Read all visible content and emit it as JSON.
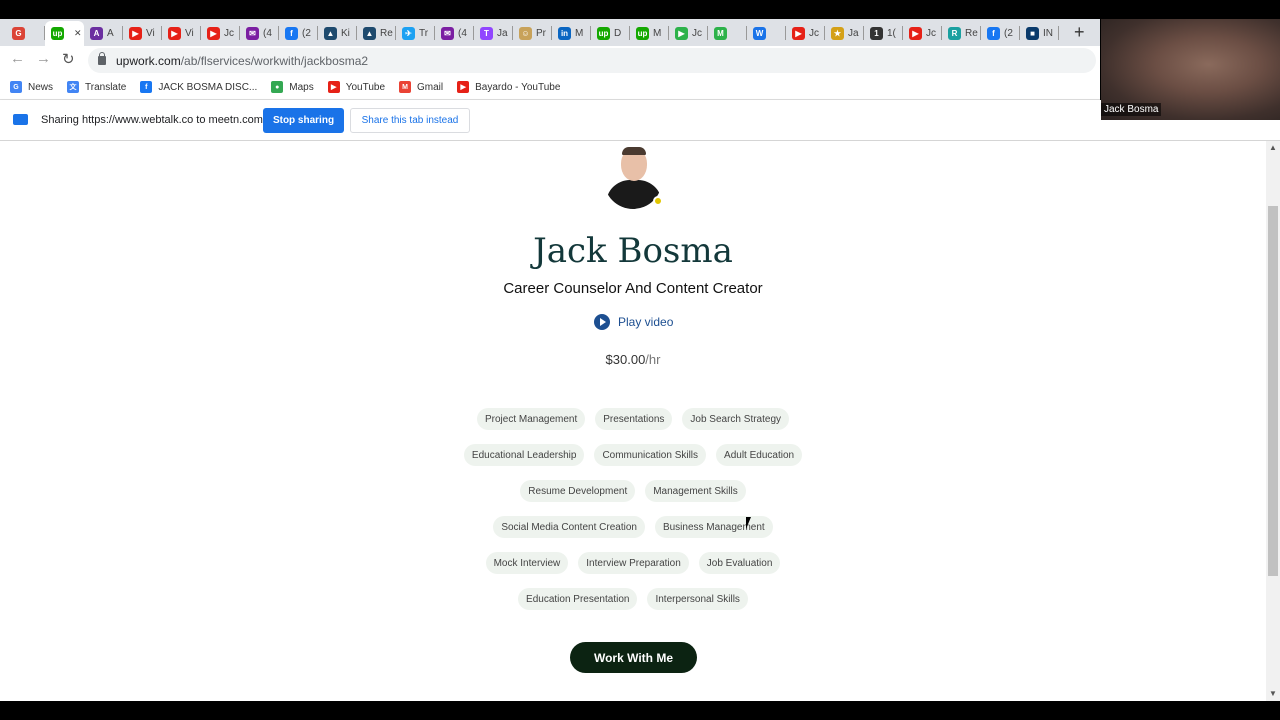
{
  "tabs": [
    {
      "label": "",
      "color": "#db4437",
      "glyph": "G"
    },
    {
      "label": "",
      "color": "#14a800",
      "glyph": "up",
      "active": true
    },
    {
      "label": "A",
      "color": "#6b2fa0",
      "glyph": "A"
    },
    {
      "label": "Vi",
      "color": "#e62117",
      "glyph": "▶"
    },
    {
      "label": "Vi",
      "color": "#e62117",
      "glyph": "▶"
    },
    {
      "label": "Jc",
      "color": "#e62117",
      "glyph": "▶"
    },
    {
      "label": "(4",
      "color": "#7b1fa2",
      "glyph": "✉"
    },
    {
      "label": "(2",
      "color": "#1877f2",
      "glyph": "f"
    },
    {
      "label": "Ki",
      "color": "#1e4a6e",
      "glyph": "▲"
    },
    {
      "label": "Re",
      "color": "#1e4a6e",
      "glyph": "▲"
    },
    {
      "label": "Tr",
      "color": "#1da1f2",
      "glyph": "✈"
    },
    {
      "label": "(4",
      "color": "#7b1fa2",
      "glyph": "✉"
    },
    {
      "label": "Ja",
      "color": "#9146ff",
      "glyph": "T"
    },
    {
      "label": "Pr",
      "color": "#c8a25a",
      "glyph": "☺"
    },
    {
      "label": "M",
      "color": "#0a66c2",
      "glyph": "in"
    },
    {
      "label": "D",
      "color": "#14a800",
      "glyph": "up"
    },
    {
      "label": "M",
      "color": "#14a800",
      "glyph": "up"
    },
    {
      "label": "Jc",
      "color": "#2db24a",
      "glyph": "▶"
    },
    {
      "label": "",
      "color": "#2db24a",
      "glyph": "M"
    },
    {
      "label": "",
      "color": "#1a73e8",
      "glyph": "W"
    },
    {
      "label": "Jc",
      "color": "#e62117",
      "glyph": "▶"
    },
    {
      "label": "Ja",
      "color": "#d4a017",
      "glyph": "★"
    },
    {
      "label": "1(",
      "color": "#333333",
      "glyph": "1"
    },
    {
      "label": "Jc",
      "color": "#e62117",
      "glyph": "▶"
    },
    {
      "label": "Re",
      "color": "#1aa0a0",
      "glyph": "R"
    },
    {
      "label": "(2",
      "color": "#1877f2",
      "glyph": "f"
    },
    {
      "label": "IN",
      "color": "#0a3a6b",
      "glyph": "■"
    }
  ],
  "toolbar": {
    "url_host": "upwork.com",
    "url_path": "/ab/flservices/workwith/jackbosma2"
  },
  "bookmarks": [
    {
      "label": "News",
      "icon": "news-icon",
      "color": "#4285f4",
      "glyph": "G"
    },
    {
      "label": "Translate",
      "icon": "translate-icon",
      "color": "#4285f4",
      "glyph": "文"
    },
    {
      "label": "JACK BOSMA DISC...",
      "icon": "facebook-icon",
      "color": "#1877f2",
      "glyph": "f"
    },
    {
      "label": "Maps",
      "icon": "maps-icon",
      "color": "#34a853",
      "glyph": "●"
    },
    {
      "label": "YouTube",
      "icon": "youtube-icon",
      "color": "#e62117",
      "glyph": "▶"
    },
    {
      "label": "Gmail",
      "icon": "gmail-icon",
      "color": "#ea4335",
      "glyph": "M"
    },
    {
      "label": "Bayardo - YouTube",
      "icon": "youtube-icon",
      "color": "#e62117",
      "glyph": "▶"
    }
  ],
  "sharing": {
    "text": "Sharing https://www.webtalk.co to meetn.com",
    "stop_label": "Stop sharing",
    "share_tab_label": "Share this tab instead"
  },
  "webcam": {
    "name": "Jack Bosma"
  },
  "profile": {
    "name": "Jack Bosma",
    "title": "Career Counselor And Content Creator",
    "play_video": "Play video",
    "rate": "$30.00",
    "rate_unit": "/hr",
    "work_button": "Work With Me"
  },
  "skills": [
    [
      "Project Management",
      "Presentations",
      "Job Search Strategy"
    ],
    [
      "Educational Leadership",
      "Communication Skills",
      "Adult Education"
    ],
    [
      "Resume Development",
      "Management Skills"
    ],
    [
      "Social Media Content Creation",
      "Business Management"
    ],
    [
      "Mock Interview",
      "Interview Preparation",
      "Job Evaluation"
    ],
    [
      "Education Presentation",
      "Interpersonal Skills"
    ]
  ],
  "colors": {
    "accent": "#1a73e8",
    "name_color": "#13383a",
    "cta_bg": "#0c2312",
    "status": "#e1c600"
  }
}
